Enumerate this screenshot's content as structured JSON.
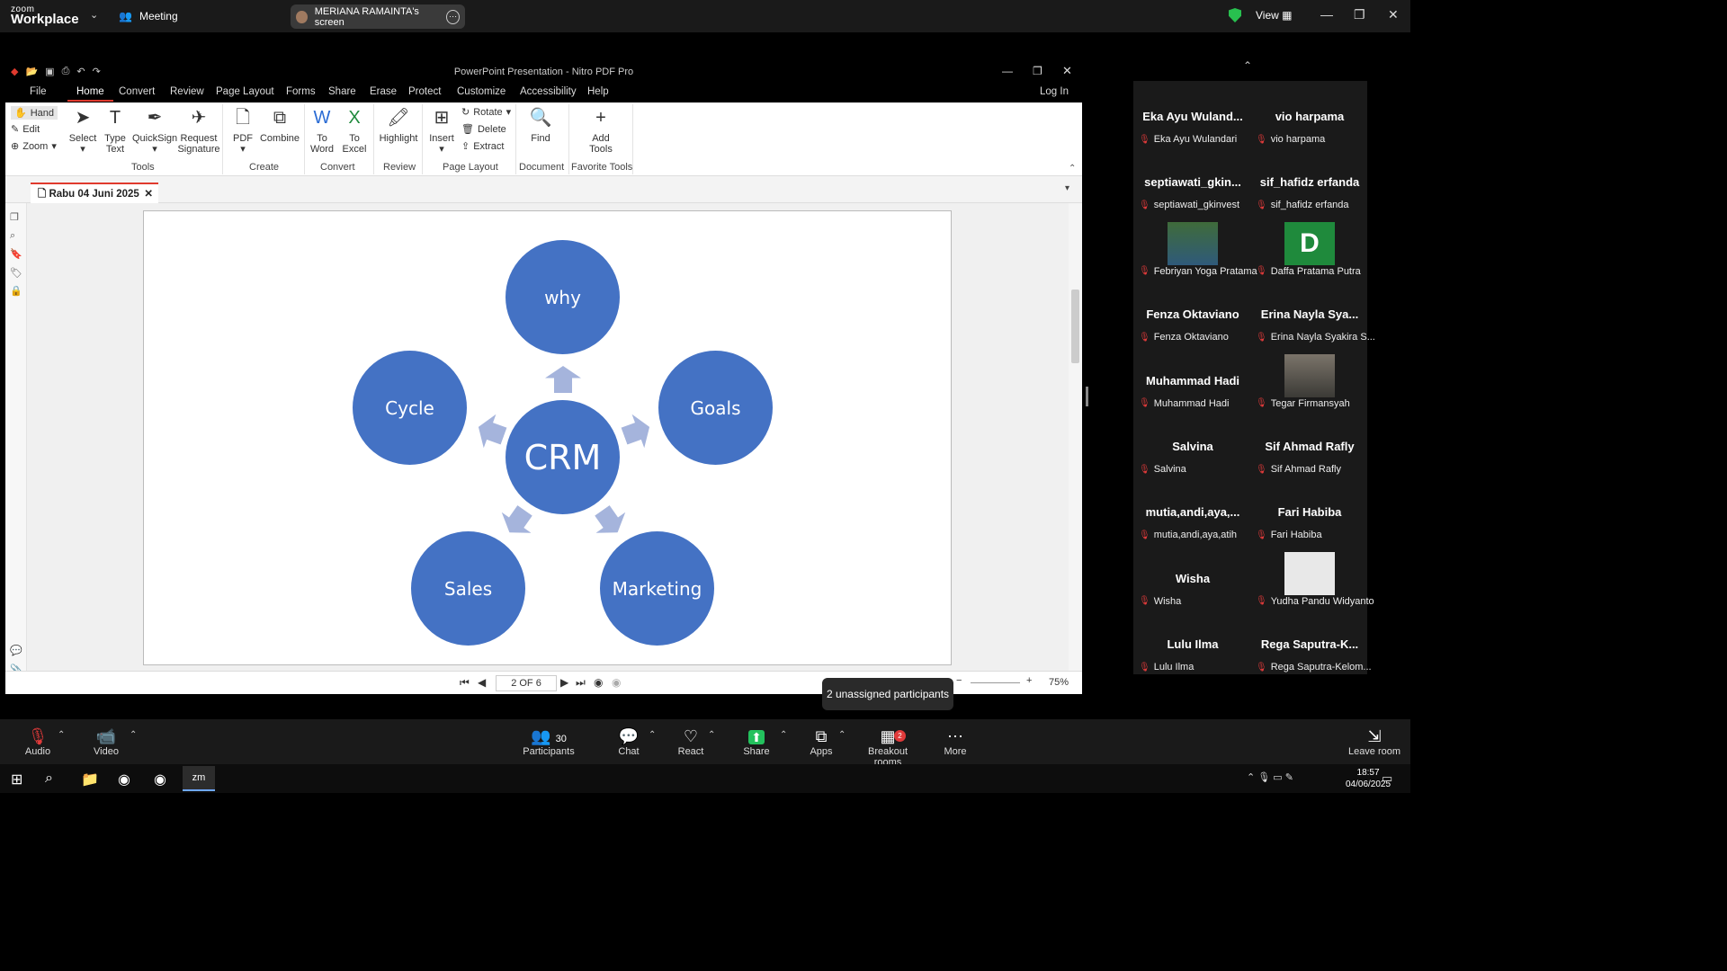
{
  "zoom": {
    "logo_top": "zoom",
    "logo_bottom": "Workplace",
    "meeting_label": "Meeting",
    "screen_share_label": "MERIANA RAMAINTA's screen",
    "view_label": "View"
  },
  "nitro": {
    "title": "PowerPoint Presentation - Nitro PDF Pro",
    "menu": [
      "File",
      "Home",
      "Convert",
      "Review",
      "Page Layout",
      "Forms",
      "Share",
      "Erase",
      "Protect",
      "Customize",
      "Accessibility",
      "Help"
    ],
    "login": "Log In",
    "left_tools": {
      "hand": "Hand",
      "edit": "Edit",
      "zoom": "Zoom"
    },
    "ribbon": {
      "select": "Select",
      "type_text": "Type\nText",
      "quicksign": "QuickSign",
      "request_signature": "Request\nSignature",
      "pdf": "PDF",
      "combine": "Combine",
      "to_word": "To\nWord",
      "to_excel": "To\nExcel",
      "highlight": "Highlight",
      "insert": "Insert",
      "rotate": "Rotate",
      "delete": "Delete",
      "extract": "Extract",
      "find": "Find",
      "add_tools": "Add\nTools"
    },
    "groups": {
      "tools": "Tools",
      "create": "Create",
      "convert": "Convert",
      "review": "Review",
      "page_layout": "Page Layout",
      "document": "Document",
      "favorite": "Favorite Tools"
    },
    "doc_tab": "Rabu 04 Juni 2025",
    "slide": {
      "center": "CRM",
      "top": "why",
      "left": "Cycle",
      "right": "Goals",
      "bottom_left": "Sales",
      "bottom_right": "Marketing"
    },
    "page_indicator": "2 OF 6",
    "zoom_level": "75%"
  },
  "participants": [
    {
      "name": "Eka Ayu Wuland...",
      "label": "Eka Ayu Wulandari"
    },
    {
      "name": "vio harpama",
      "label": "vio harpama"
    },
    {
      "name": "septiawati_gkin...",
      "label": "septiawati_gkinvest"
    },
    {
      "name": "sif_hafidz erfanda",
      "label": "sif_hafidz erfanda"
    },
    {
      "name": "",
      "label": "Febriyan Yoga Pratama",
      "video": "photo"
    },
    {
      "name": "",
      "label": "Daffa Pratama Putra",
      "video": "letter",
      "letter": "D"
    },
    {
      "name": "Fenza Oktaviano",
      "label": "Fenza Oktaviano"
    },
    {
      "name": "Erina Nayla Sya...",
      "label": "Erina Nayla Syakira S..."
    },
    {
      "name": "Muhammad Hadi",
      "label": "Muhammad Hadi"
    },
    {
      "name": "",
      "label": "Tegar Firmansyah",
      "video": "photo"
    },
    {
      "name": "Salvina",
      "label": "Salvina"
    },
    {
      "name": "Sif Ahmad Rafly",
      "label": "Sif Ahmad Rafly"
    },
    {
      "name": "mutia,andi,aya,...",
      "label": "mutia,andi,aya,atih"
    },
    {
      "name": "Fari Habiba",
      "label": "Fari Habiba"
    },
    {
      "name": "Wisha",
      "label": "Wisha"
    },
    {
      "name": "",
      "label": "Yudha Pandu Widyanto",
      "video": "avatar"
    },
    {
      "name": "Lulu Ilma",
      "label": "Lulu Ilma"
    },
    {
      "name": "Rega  Saputra-K...",
      "label": "Rega Saputra-Kelom..."
    }
  ],
  "tooltip": "2 unassigned participants",
  "controls": {
    "audio": "Audio",
    "video": "Video",
    "participants": "Participants",
    "participants_count": "30",
    "chat": "Chat",
    "react": "React",
    "share": "Share",
    "apps": "Apps",
    "breakout": "Breakout rooms",
    "breakout_badge": "2",
    "more": "More",
    "leave": "Leave room"
  },
  "taskbar": {
    "time": "18:57",
    "date": "04/06/2025"
  }
}
